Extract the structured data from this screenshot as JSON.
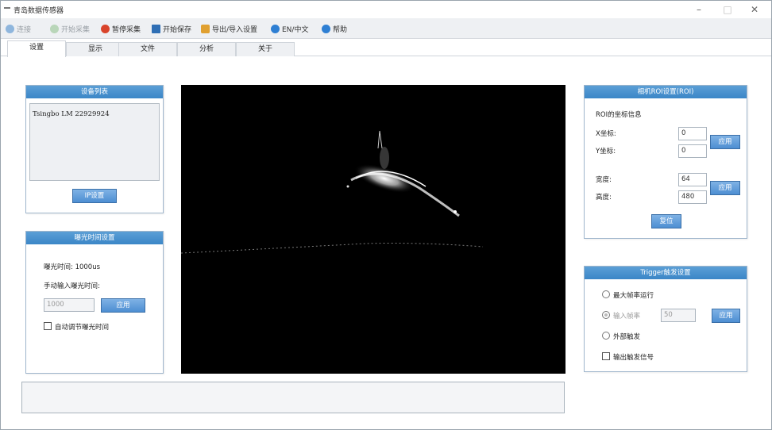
{
  "window": {
    "title": "青岛数据传感器",
    "minimize": "–",
    "maximize": "□",
    "close": "✕"
  },
  "toolbar": [
    {
      "label": "连接",
      "icon": "connect-icon",
      "color": "#8fb6dd",
      "enabled": false
    },
    {
      "label": "开始采集",
      "icon": "start-capture-icon",
      "color": "#9ec59e",
      "enabled": false
    },
    {
      "label": "暂停采集",
      "icon": "stop-capture-icon",
      "color": "#d9442b",
      "enabled": true
    },
    {
      "label": "开始保存",
      "icon": "save-icon",
      "color": "#2f6fb5",
      "enabled": true
    },
    {
      "label": "导出/导入设置",
      "icon": "import-export-icon",
      "color": "#e0a030",
      "enabled": true
    },
    {
      "label": "EN/中文",
      "icon": "language-icon",
      "color": "#2e7fd3",
      "enabled": true
    },
    {
      "label": "帮助",
      "icon": "help-icon",
      "color": "#2e7fd3",
      "enabled": true
    }
  ],
  "tabs": [
    "设置",
    "显示",
    "文件",
    "分析",
    "关于"
  ],
  "device_panel": {
    "title": "设备列表",
    "device": "Tsingbo LM 22929924",
    "button": "IP设置"
  },
  "exposure_panel": {
    "title": "曝光时间设置",
    "exposure_label": "曝光时间: 1000us",
    "manual_label": "手动输入曝光时间:",
    "value": "1000",
    "apply": "应用",
    "auto_label": "自动调节曝光时间"
  },
  "roi_panel": {
    "title": "相机ROI设置(ROI)",
    "info": "ROI的坐标信息",
    "x_label": "X坐标:",
    "x_value": "0",
    "y_label": "Y坐标:",
    "y_value": "0",
    "apply_xy": "应用",
    "width_label": "宽度:",
    "width_value": "64",
    "height_label": "高度:",
    "height_value": "480",
    "apply_wh": "应用",
    "reset": "复位"
  },
  "trigger_panel": {
    "title": "Trigger触发设置",
    "opt1": "最大帧率运行",
    "opt2": "输入帧率",
    "opt2_value": "50",
    "apply": "应用",
    "opt3": "外部触发",
    "check": "输出触发信号"
  },
  "status": {
    "text": ""
  }
}
